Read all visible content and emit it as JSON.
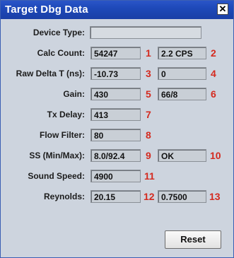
{
  "window": {
    "title": "Target Dbg Data",
    "close_glyph": "☒",
    "close_icon": "close-icon"
  },
  "rows": [
    {
      "label": "Device Type:",
      "value": "",
      "value2": null,
      "num1": "",
      "num2": ""
    },
    {
      "label": "Calc Count:",
      "value": "54247",
      "value2": "2.2 CPS",
      "num1": "1",
      "num2": "2"
    },
    {
      "label": "Raw Delta T (ns):",
      "value": "-10.73",
      "value2": "0",
      "num1": "3",
      "num2": "4"
    },
    {
      "label": "Gain:",
      "value": "430",
      "value2": "66/8",
      "num1": "5",
      "num2": "6"
    },
    {
      "label": "Tx Delay:",
      "value": "413",
      "value2": null,
      "num1": "7",
      "num2": ""
    },
    {
      "label": "Flow Filter:",
      "value": "80",
      "value2": null,
      "num1": "8",
      "num2": ""
    },
    {
      "label": "SS (Min/Max):",
      "value": "8.0/92.4",
      "value2": "OK",
      "num1": "9",
      "num2": "10"
    },
    {
      "label": "Sound Speed:",
      "value": "4900",
      "value2": null,
      "num1": "11",
      "num2": ""
    },
    {
      "label": "Reynolds:",
      "value": "20.15",
      "value2": "0.7500",
      "num1": "12",
      "num2": "13"
    }
  ],
  "buttons": {
    "reset_label": "Reset"
  }
}
